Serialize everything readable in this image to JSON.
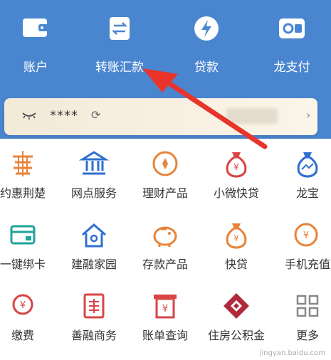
{
  "colors": {
    "header_bg": "#4a86d0",
    "accent_blue": "#2f6fd0",
    "icon_orange": "#e8833a",
    "icon_red": "#d94444",
    "arrow_red": "#e8342b"
  },
  "top_nav": {
    "items": [
      {
        "label": "账户",
        "icon": "wallet-icon"
      },
      {
        "label": "转账汇款",
        "icon": "transfer-icon"
      },
      {
        "label": "贷款",
        "icon": "loan-icon"
      },
      {
        "label": "龙支付",
        "icon": "long-pay-icon"
      }
    ]
  },
  "balance_bar": {
    "masked_value": "****",
    "refresh_icon": "refresh-icon",
    "eye_icon": "eye-closed-icon"
  },
  "grid": {
    "items": [
      {
        "label": "约惠荆楚",
        "icon": "pagoda-icon"
      },
      {
        "label": "网点服务",
        "icon": "bank-building-icon"
      },
      {
        "label": "理财产品",
        "icon": "coin-icon"
      },
      {
        "label": "小微快贷",
        "icon": "money-bag-icon"
      },
      {
        "label": "龙宝",
        "icon": "long-bao-bag-icon"
      },
      {
        "label": "一键绑卡",
        "icon": "bind-card-icon"
      },
      {
        "label": "建融家园",
        "icon": "home-icon"
      },
      {
        "label": "存款产品",
        "icon": "piggy-bank-icon"
      },
      {
        "label": "快贷",
        "icon": "quick-loan-bag-icon"
      },
      {
        "label": "手机充值",
        "icon": "phone-recharge-icon"
      },
      {
        "label": "缴费",
        "icon": "payment-icon"
      },
      {
        "label": "善融商务",
        "icon": "shanrong-icon"
      },
      {
        "label": "账单查询",
        "icon": "bill-icon"
      },
      {
        "label": "住房公积金",
        "icon": "housing-fund-icon"
      },
      {
        "label": "更多",
        "icon": "more-grid-icon"
      }
    ]
  },
  "watermark": "jingyan.baidu.com"
}
